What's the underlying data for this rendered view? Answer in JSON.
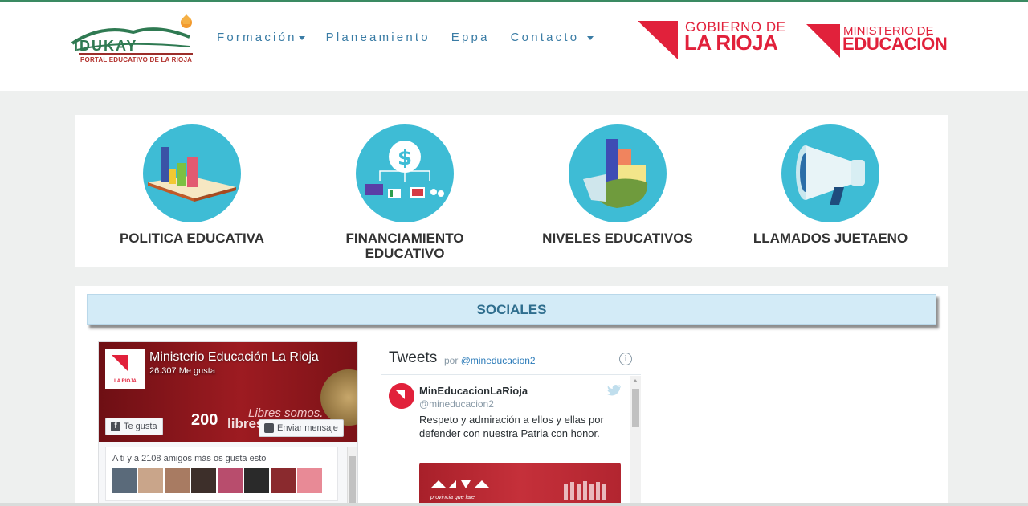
{
  "header": {
    "logo_text": "IDUKAY",
    "logo_subtitle": "PORTAL EDUCATIVO DE LA RIOJA",
    "nav": [
      {
        "label": "Formación",
        "dropdown": true
      },
      {
        "label": "Planeamiento",
        "dropdown": false
      },
      {
        "label": "Eppa",
        "dropdown": false
      },
      {
        "label": "Contacto",
        "dropdown": true
      }
    ],
    "gobierno_line1": "GOBIERNO DE",
    "gobierno_line2": "LA RIOJA",
    "ministerio_line1": "MINISTERIO DE",
    "ministerio_line2": "EDUCACIÓN"
  },
  "categories": [
    {
      "label": "POLITICA EDUCATIVA",
      "icon": "book-chart-icon"
    },
    {
      "label": "FINANCIAMIENTO EDUCATIVO",
      "icon": "finance-icon"
    },
    {
      "label": "NIVELES EDUCATIVOS",
      "icon": "pie-chart-icon"
    },
    {
      "label": "LLAMADOS JUETAENO",
      "icon": "megaphone-icon"
    }
  ],
  "sociales": {
    "title": "SOCIALES"
  },
  "facebook": {
    "page_name": "Ministerio Educación La Rioja",
    "likes": "26.307 Me gusta",
    "avatar_text": "LA RIOJA",
    "cover_number": "200",
    "cover_slogan": "Libres somos.",
    "cover_slogan2": "libres",
    "like_button": "Te gusta",
    "message_button": "Enviar mensaje",
    "friends_text": "A ti y a 2108 amigos más os gusta esto"
  },
  "twitter": {
    "title": "Tweets",
    "by_prefix": "por",
    "by_handle": "@mineducacion2",
    "tweet_user": "MinEducacionLaRioja",
    "tweet_handle": "@mineducacion2",
    "tweet_text": "Respeto y admiración a ellos y ellas por defender con nuestra Patria con honor.",
    "media_caption": "provincia que late"
  },
  "colors": {
    "accent_blue": "#3a7ca5",
    "brand_red": "#e1213b",
    "circle_cyan": "#3ebcd5"
  }
}
